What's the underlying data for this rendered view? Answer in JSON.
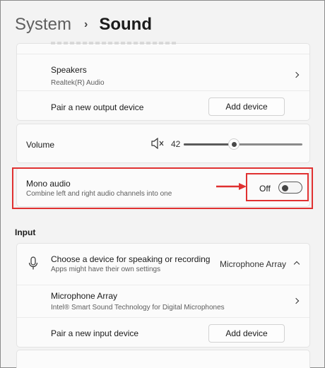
{
  "breadcrumb": {
    "parent": "System",
    "current": "Sound"
  },
  "output": {
    "speakers": {
      "title": "Speakers",
      "subtitle": "Realtek(R) Audio"
    },
    "pair_label": "Pair a new output device",
    "add_device_label": "Add device"
  },
  "volume": {
    "label": "Volume",
    "value": "42",
    "level_percent": 42,
    "icon": "speaker-muted-icon"
  },
  "mono_audio": {
    "title": "Mono audio",
    "subtitle": "Combine left and right audio channels into one",
    "state_label": "Off",
    "enabled": false
  },
  "input": {
    "section_label": "Input",
    "choose": {
      "title": "Choose a device for speaking or recording",
      "subtitle": "Apps might have their own settings",
      "selected": "Microphone Array"
    },
    "mic_array": {
      "title": "Microphone Array",
      "subtitle": "Intel® Smart Sound Technology for Digital Microphones"
    },
    "pair_label": "Pair a new input device",
    "add_device_label": "Add device"
  },
  "colors": {
    "highlight": "#e03131",
    "background": "#f3f3f3",
    "card": "#fbfbfb"
  }
}
